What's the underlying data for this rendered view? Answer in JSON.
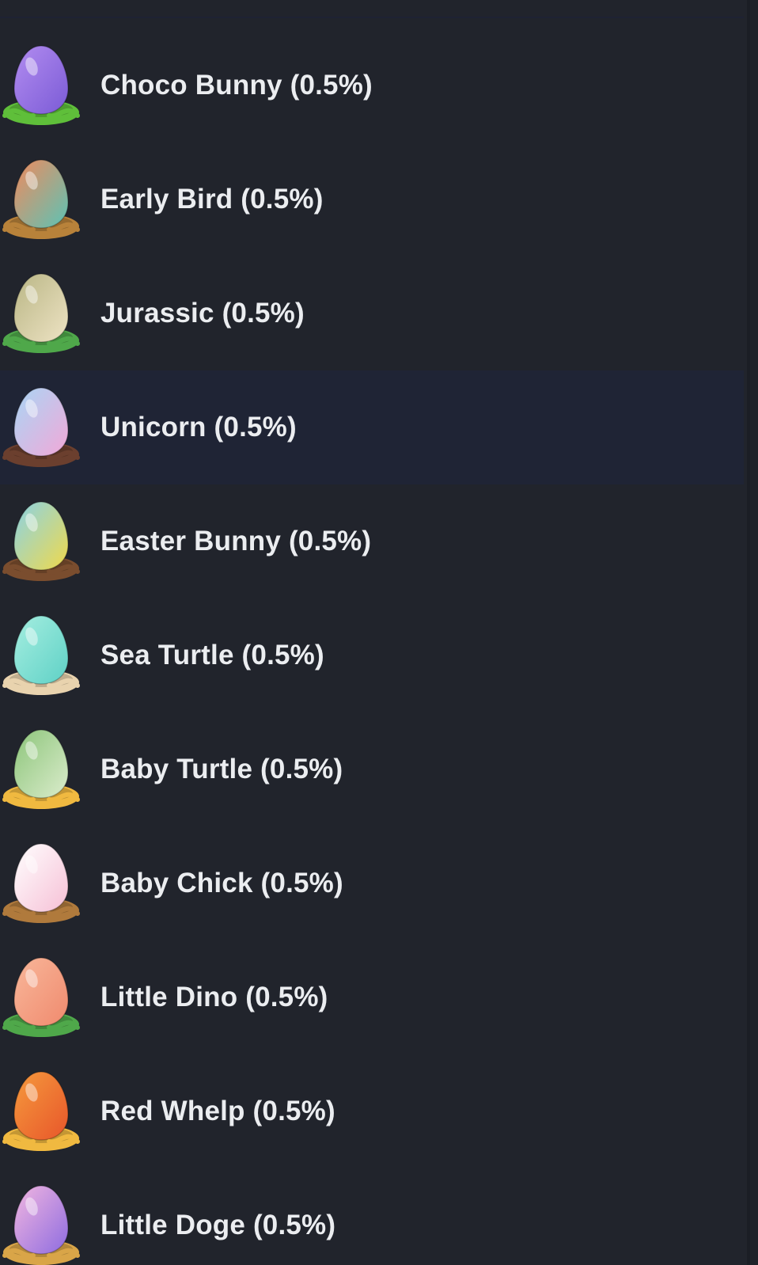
{
  "items": [
    {
      "label": "Choco Bunny (0.5%)",
      "icon": "choco-bunny-egg-icon",
      "colors": {
        "egg": "#7b5bd6",
        "egg_light": "#b28cf0",
        "base": "#5fbf3a"
      }
    },
    {
      "label": "Early Bird (0.5%)",
      "icon": "early-bird-egg-icon",
      "colors": {
        "egg": "#5cc3b5",
        "egg_light": "#f08a5d",
        "base": "#b8823a"
      }
    },
    {
      "label": "Jurassic (0.5%)",
      "icon": "jurassic-egg-icon",
      "colors": {
        "egg": "#eee3c4",
        "egg_light": "#b9b685",
        "base": "#4fa84a"
      }
    },
    {
      "label": "Unicorn (0.5%)",
      "icon": "unicorn-egg-icon",
      "colors": {
        "egg": "#f2a8d8",
        "egg_light": "#a9d6f5",
        "base": "#6b3f2e"
      }
    },
    {
      "label": "Easter Bunny (0.5%)",
      "icon": "easter-bunny-egg-icon",
      "colors": {
        "egg": "#f0d94b",
        "egg_light": "#8ad3e6",
        "base": "#7a4d2e"
      }
    },
    {
      "label": "Sea Turtle (0.5%)",
      "icon": "sea-turtle-egg-icon",
      "colors": {
        "egg": "#5fd1c6",
        "egg_light": "#a5eee0",
        "base": "#e9d3ae"
      }
    },
    {
      "label": "Baby Turtle (0.5%)",
      "icon": "baby-turtle-egg-icon",
      "colors": {
        "egg": "#dbeccc",
        "egg_light": "#8cc57a",
        "base": "#f0b940"
      }
    },
    {
      "label": "Baby Chick (0.5%)",
      "icon": "baby-chick-egg-icon",
      "colors": {
        "egg": "#f6c0d6",
        "egg_light": "#ffffff",
        "base": "#b07a3c"
      }
    },
    {
      "label": "Little Dino (0.5%)",
      "icon": "little-dino-egg-icon",
      "colors": {
        "egg": "#f08a6e",
        "egg_light": "#f8b79a",
        "base": "#4fa84a"
      }
    },
    {
      "label": "Red Whelp (0.5%)",
      "icon": "red-whelp-egg-icon",
      "colors": {
        "egg": "#e8562a",
        "egg_light": "#f59a3d",
        "base": "#f0b940"
      }
    },
    {
      "label": "Little Doge (0.5%)",
      "icon": "little-doge-egg-icon",
      "colors": {
        "egg": "#8e6ce0",
        "egg_light": "#f2b6e0",
        "base": "#d9a548"
      }
    }
  ],
  "highlighted_index": 3,
  "theme": {
    "background": "#21242c",
    "highlight": "#1f2435",
    "text": "#ebedf0"
  }
}
